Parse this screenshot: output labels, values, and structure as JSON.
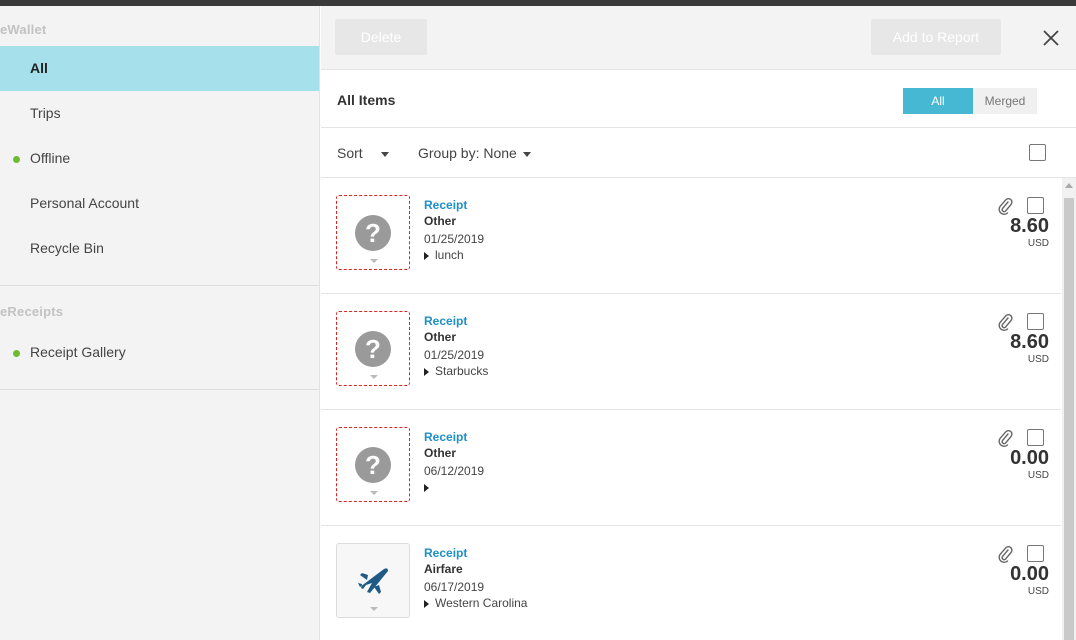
{
  "sidebar": {
    "section1_title": "eWallet",
    "items": [
      {
        "label": "All",
        "active": true,
        "dot": false
      },
      {
        "label": "Trips",
        "active": false,
        "dot": false
      },
      {
        "label": "Offline",
        "active": false,
        "dot": true
      },
      {
        "label": "Personal Account",
        "active": false,
        "dot": false
      },
      {
        "label": "Recycle Bin",
        "active": false,
        "dot": false
      }
    ],
    "section2_title": "eReceipts",
    "items2": [
      {
        "label": "Receipt Gallery",
        "dot": true
      }
    ]
  },
  "toolbar": {
    "delete_label": "Delete",
    "add_label": "Add to Report",
    "close_icon": "close-icon"
  },
  "header": {
    "title": "All Items",
    "seg_all": "All",
    "seg_merged": "Merged",
    "selected": "All"
  },
  "sortbar": {
    "sort_label": "Sort",
    "group_label": "Group by: None"
  },
  "colors": {
    "active_nav": "#a6e0ea",
    "accent": "#46b8d3",
    "link": "#1e90c7",
    "status_dot": "#6dbb2e"
  },
  "items": [
    {
      "type": "Receipt",
      "category": "Other",
      "date": "01/25/2019",
      "desc": "lunch",
      "amount": "8.60",
      "currency": "USD",
      "icon": "question-icon"
    },
    {
      "type": "Receipt",
      "category": "Other",
      "date": "01/25/2019",
      "desc": "Starbucks",
      "amount": "8.60",
      "currency": "USD",
      "icon": "question-icon"
    },
    {
      "type": "Receipt",
      "category": "Other",
      "date": "06/12/2019",
      "desc": "",
      "amount": "0.00",
      "currency": "USD",
      "icon": "question-icon"
    },
    {
      "type": "Receipt",
      "category": "Airfare",
      "date": "06/17/2019",
      "desc": "Western Carolina",
      "amount": "0.00",
      "currency": "USD",
      "icon": "airplane-icon"
    }
  ]
}
